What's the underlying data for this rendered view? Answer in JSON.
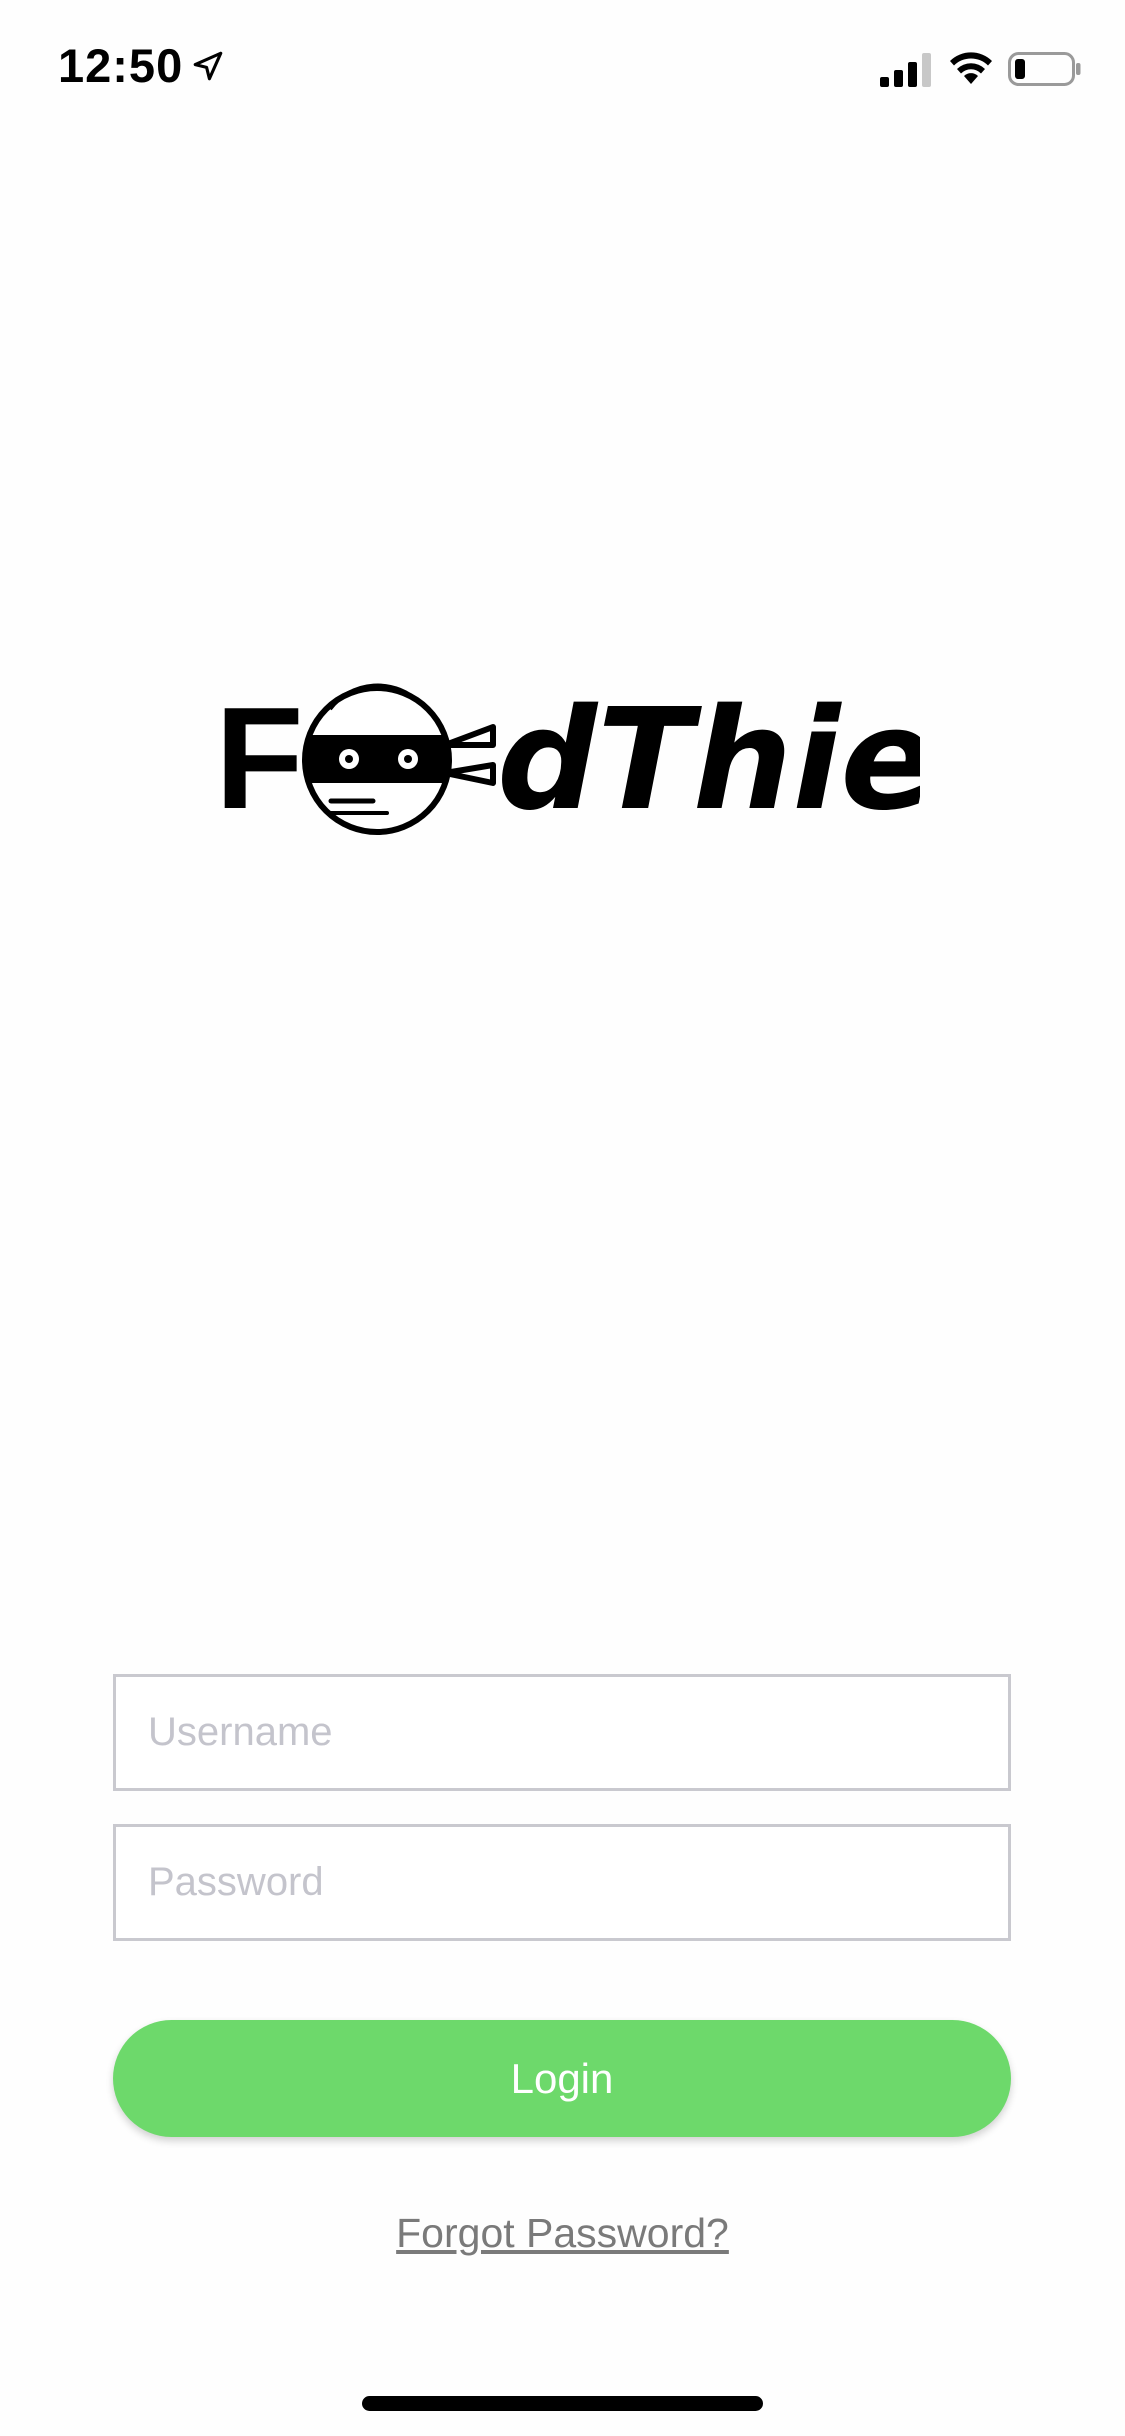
{
  "status_bar": {
    "time": "12:50",
    "icons": [
      "location-arrow-icon",
      "cellular-signal-icon",
      "wifi-icon",
      "battery-icon"
    ]
  },
  "logo": {
    "text": "FoodThief",
    "text_left": "F",
    "text_right": "dThief",
    "icon": "ninja-face-icon"
  },
  "form": {
    "username": {
      "value": "",
      "placeholder": "Username"
    },
    "password": {
      "value": "",
      "placeholder": "Password"
    },
    "login_label": "Login",
    "forgot_label": "Forgot Password?"
  },
  "colors": {
    "accent": "#6dd96b",
    "field_border": "#c9c9cf",
    "placeholder": "#c4c4cc",
    "link": "#7a7a7a"
  }
}
